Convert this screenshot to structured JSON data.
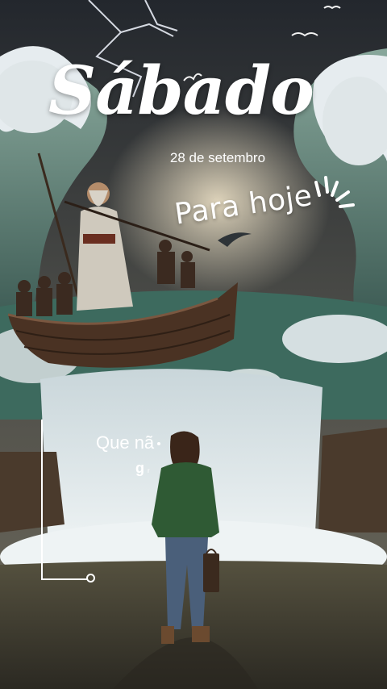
{
  "story": {
    "title": "Sábado",
    "date": "28 de setembro",
    "subtitle": "Para hoje",
    "caption_line1": "Que nã",
    "caption_line2": "g",
    "caption_line2_small": "r"
  },
  "colors": {
    "sky_top": "#2a2f36",
    "wave_green": "#3d6a5e",
    "foam": "#e6ecef",
    "boat_brown": "#4a3223",
    "ground": "#3b372e",
    "sweater_green": "#2f5a34",
    "jeans": "#4a5f7a"
  },
  "icons": [
    "lightning-bolt",
    "seagull",
    "sunburst-accent"
  ]
}
